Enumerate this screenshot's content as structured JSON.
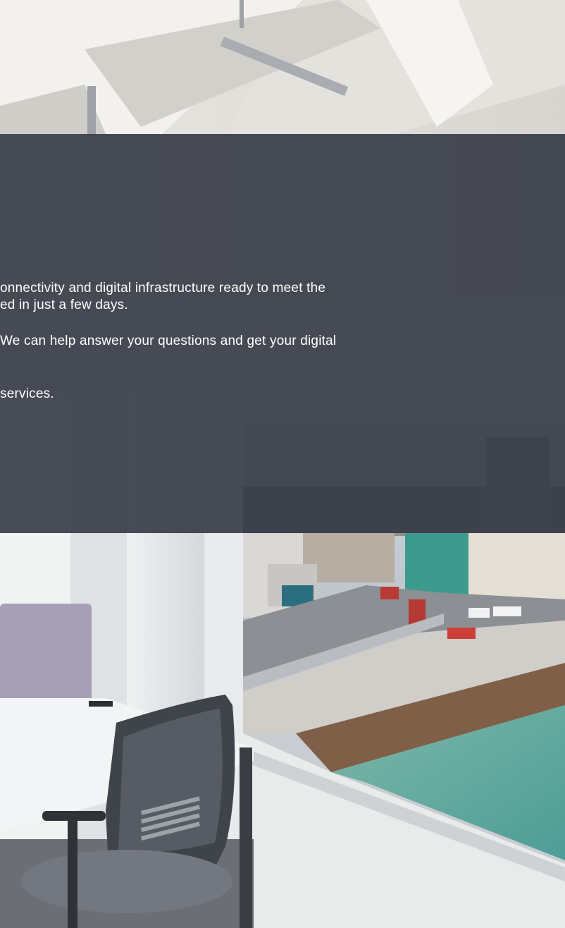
{
  "hero": {
    "alt_scene": "office interior",
    "paragraphs": [
      "onnectivity and digital infrastructure ready to meet the",
      "ed in just a few days.",
      "We can help answer your questions and get your digital",
      "services."
    ]
  },
  "colors": {
    "overlay": "#343944",
    "sea": "#5fa79a",
    "ceiling": "#e3e1dc"
  }
}
